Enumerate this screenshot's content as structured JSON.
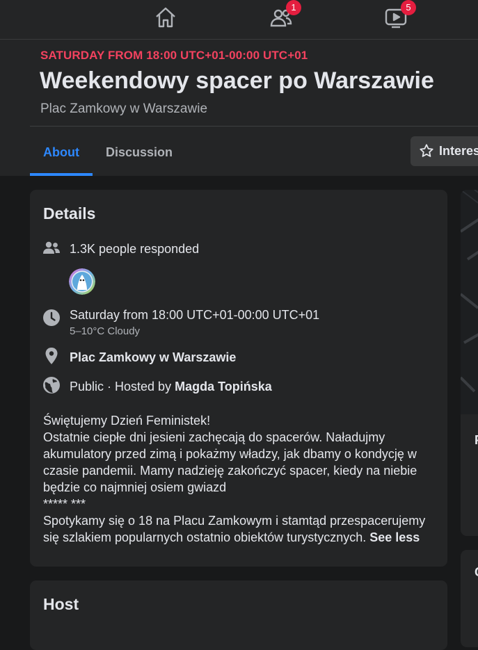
{
  "nav": {
    "friends_badge": "1",
    "watch_badge": "5"
  },
  "event": {
    "date_line": "SATURDAY FROM 18:00 UTC+01-00:00 UTC+01",
    "title": "Weekendowy spacer po Warszawie",
    "location": "Plac Zamkowy w Warszawie"
  },
  "tabs": {
    "about": "About",
    "discussion": "Discussion"
  },
  "interested_button": "Interested",
  "details": {
    "heading": "Details",
    "responded": "1.3K people responded",
    "time": "Saturday from 18:00 UTC+01-00:00 UTC+01",
    "weather": "5–10°C Cloudy",
    "place": "Plac Zamkowy w Warszawie",
    "privacy_prefix": "Public · Hosted by ",
    "host_name": "Magda Topińska",
    "description": [
      "Świętujemy Dzień Feministek!",
      "Ostatnie ciepłe dni jesieni zachęcają do spacerów. Naładujmy akumulatory przed zimą i pokażmy władzy, jak dbamy o kondycję w czasie pandemii. Mamy nadzieję zakończyć spacer, kiedy na niebie będzie co najmniej osiem gwiazd",
      "***** ***"
    ],
    "description_last": "Spotykamy się o 18 na Placu Zamkowym i stamtąd przespacerujemy się szlakiem popularnych ostatnio obiektów turystycznych.",
    "see_less": "See less"
  },
  "host_card": {
    "heading": "Host"
  },
  "colors": {
    "accent": "#2d88ff",
    "date_red": "#f3425f",
    "badge_red": "#e41e3f"
  },
  "icons": [
    "home-icon",
    "friends-icon",
    "watch-icon",
    "star-icon",
    "people-icon",
    "clock-icon",
    "location-pin-icon",
    "globe-icon"
  ]
}
